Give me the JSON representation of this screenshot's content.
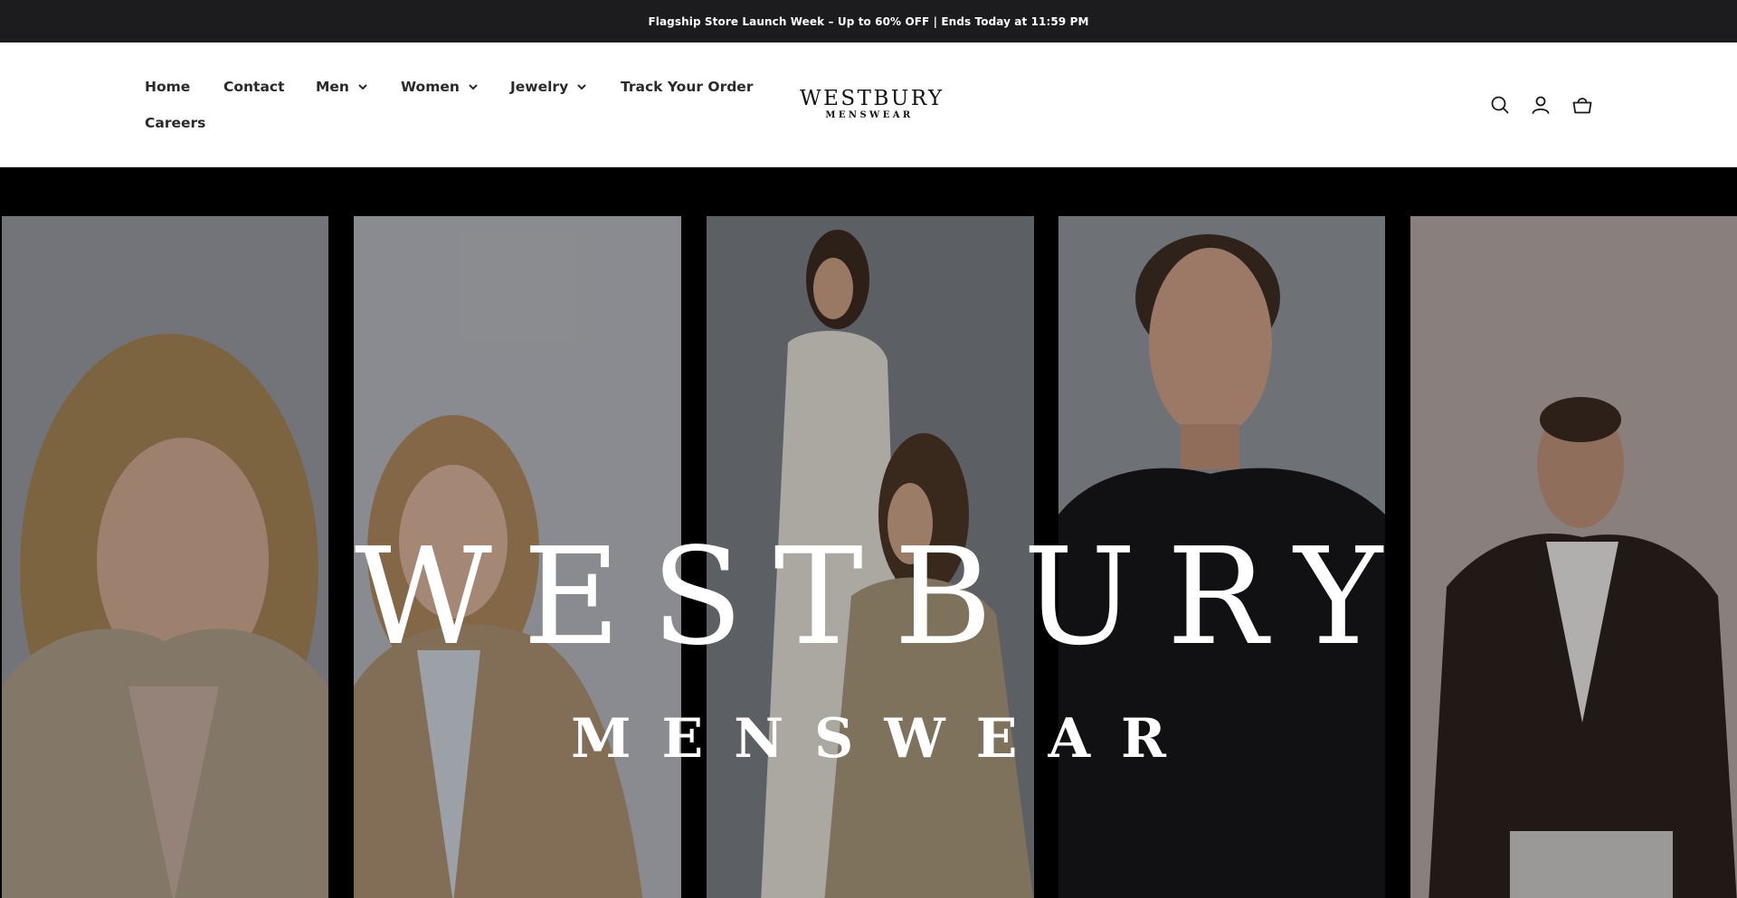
{
  "announcement": {
    "text": "Flagship Store Launch Week – Up to 60% OFF | Ends Today at 11:59 PM"
  },
  "nav": {
    "items": [
      {
        "label": "Home",
        "has_dropdown": false
      },
      {
        "label": "Contact",
        "has_dropdown": false
      },
      {
        "label": "Men",
        "has_dropdown": true
      },
      {
        "label": "Women",
        "has_dropdown": true
      },
      {
        "label": "Jewelry",
        "has_dropdown": true
      },
      {
        "label": "Track Your Order",
        "has_dropdown": false
      },
      {
        "label": "Careers",
        "has_dropdown": false
      }
    ]
  },
  "logo": {
    "main": "WESTBURY",
    "sub": "MENSWEAR"
  },
  "header_icons": [
    "search-icon",
    "account-icon",
    "cart-icon"
  ],
  "hero": {
    "title": "WESTBURY",
    "subtitle": "MENSWEAR",
    "panels": [
      "woman-beige-blazer-portrait",
      "woman-tan-blazer-smiling",
      "women-white-coat-and-trench",
      "man-black-tshirt-portrait",
      "man-black-jacket-seated"
    ]
  },
  "colors": {
    "announcement_bg": "#1c1c1e",
    "header_bg": "#ffffff",
    "text_dark": "#2a2a2a",
    "hero_text": "#ffffff"
  }
}
